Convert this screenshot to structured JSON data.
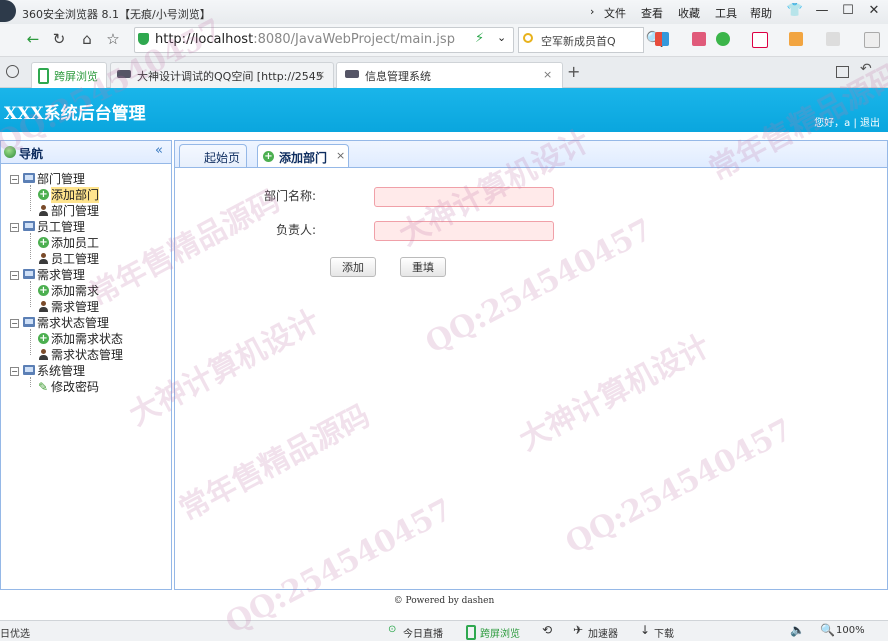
{
  "browser": {
    "title": "360安全浏览器 8.1【无痕/小号浏览】",
    "menu": [
      "文件",
      "查看",
      "收藏",
      "工具",
      "帮助"
    ],
    "address_host": "http://localhost",
    "address_path": ":8080/JavaWebProject/main.jsp",
    "search_text": "空军新成员首Q",
    "tabs": [
      {
        "label": "跨屏浏览"
      },
      {
        "label": "大神设计调试的QQ空间 [http://2545"
      },
      {
        "label": "信息管理系统"
      }
    ],
    "status": {
      "left": "日优选",
      "items": [
        "今日直播",
        "跨屏浏览",
        "加速器",
        "下载"
      ],
      "zoom": "100%"
    }
  },
  "app": {
    "title": "XXX系统后台管理",
    "user_line": "您好，a | 退出"
  },
  "nav": {
    "title": "导航",
    "collapse": "«",
    "groups": [
      {
        "label": "部门管理",
        "items": [
          {
            "label": "添加部门",
            "icon": "add-icon",
            "selected": true
          },
          {
            "label": "部门管理",
            "icon": "user-icon"
          }
        ]
      },
      {
        "label": "员工管理",
        "items": [
          {
            "label": "添加员工",
            "icon": "add-icon"
          },
          {
            "label": "员工管理",
            "icon": "user-icon"
          }
        ]
      },
      {
        "label": "需求管理",
        "items": [
          {
            "label": "添加需求",
            "icon": "add-icon"
          },
          {
            "label": "需求管理",
            "icon": "user-icon"
          }
        ]
      },
      {
        "label": "需求状态管理",
        "items": [
          {
            "label": "添加需求状态",
            "icon": "add-icon"
          },
          {
            "label": "需求状态管理",
            "icon": "user-icon"
          }
        ]
      },
      {
        "label": "系统管理",
        "items": [
          {
            "label": "修改密码",
            "icon": "pencil-icon"
          }
        ]
      }
    ]
  },
  "center": {
    "tabs": [
      {
        "label": "起始页"
      },
      {
        "label": "添加部门",
        "close": "×"
      }
    ],
    "form": {
      "dept_name_label": "部门名称:",
      "dept_name_value": "",
      "manager_label": "负责人:",
      "manager_value": "",
      "add_button": "添加",
      "reset_button": "重填"
    }
  },
  "footer": "© Powered by dashen",
  "watermark": [
    "QQ:254540457",
    "大神计算机设计",
    "常年售精品源码"
  ]
}
